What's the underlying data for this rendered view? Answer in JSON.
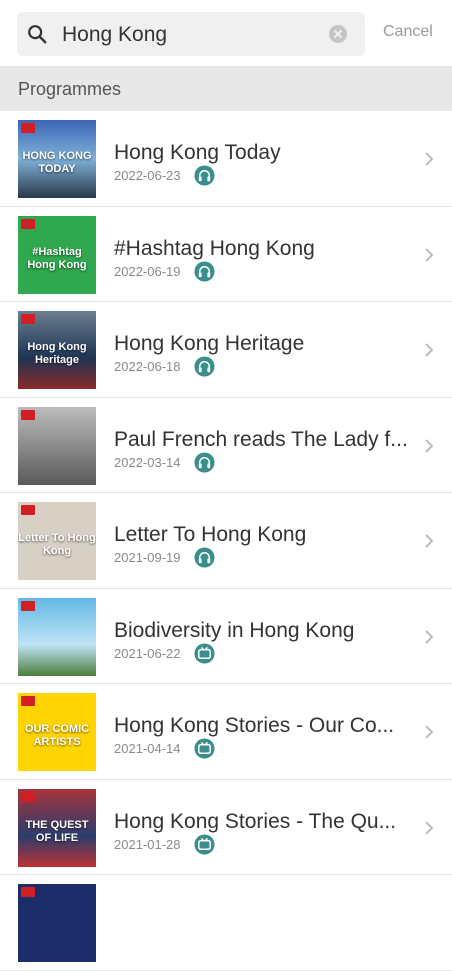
{
  "search": {
    "query": "Hong Kong",
    "cancel_label": "Cancel"
  },
  "section": {
    "title": "Programmes"
  },
  "colors": {
    "media_icon": "#3a8e8c",
    "chevron": "#bdbdbd",
    "section_bg": "#e8e8e8"
  },
  "items": [
    {
      "title": "Hong Kong Today",
      "date": "2022-06-23",
      "media": "headphones-icon",
      "thumb_text": "HONG KONG TODAY"
    },
    {
      "title": "#Hashtag Hong Kong",
      "date": "2022-06-19",
      "media": "headphones-icon",
      "thumb_text": "#Hashtag Hong Kong"
    },
    {
      "title": "Hong Kong Heritage",
      "date": "2022-06-18",
      "media": "headphones-icon",
      "thumb_text": "Hong Kong Heritage"
    },
    {
      "title": "Paul French reads The Lady f...",
      "date": "2022-03-14",
      "media": "headphones-icon",
      "thumb_text": ""
    },
    {
      "title": "Letter To Hong Kong",
      "date": "2021-09-19",
      "media": "headphones-icon",
      "thumb_text": "Letter To Hong Kong"
    },
    {
      "title": "Biodiversity in Hong Kong",
      "date": "2021-06-22",
      "media": "tv-icon",
      "thumb_text": ""
    },
    {
      "title": "Hong Kong Stories - Our Co...",
      "date": "2021-04-14",
      "media": "tv-icon",
      "thumb_text": "OUR COMIC ARTISTS"
    },
    {
      "title": "Hong Kong Stories  - The Qu...",
      "date": "2021-01-28",
      "media": "tv-icon",
      "thumb_text": "THE QUEST OF LIFE"
    },
    {
      "title": "",
      "date": "",
      "media": "",
      "thumb_text": ""
    }
  ]
}
